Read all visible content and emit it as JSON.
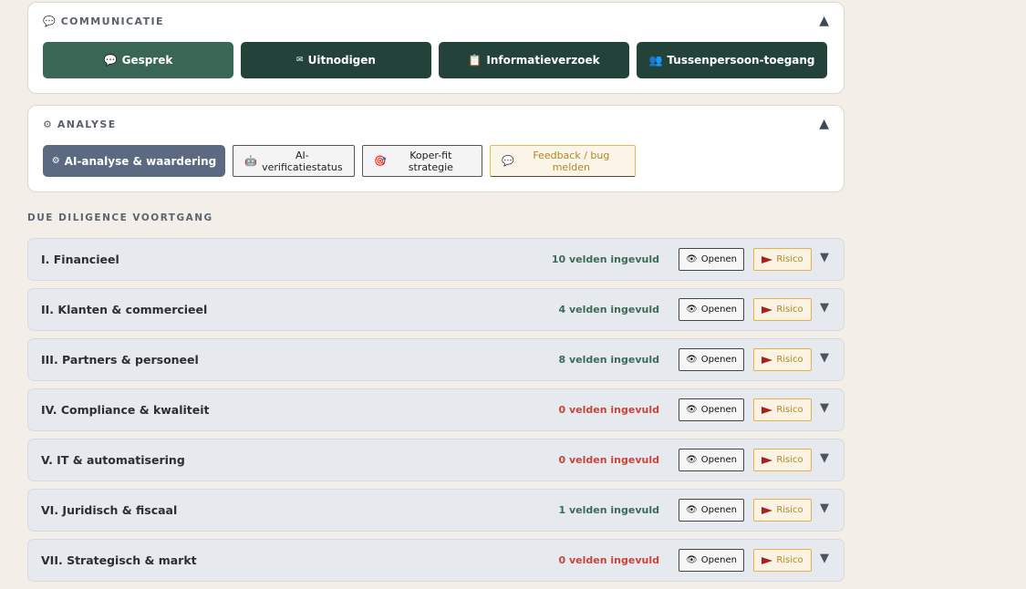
{
  "communicatie": {
    "icon": "💬",
    "title": "COMMUNICATIE",
    "collapse_icon": "▲",
    "buttons": [
      {
        "icon": "💬",
        "label": "Gesprek"
      },
      {
        "icon": "✉",
        "label": "Uitnodigen"
      },
      {
        "icon": "📋",
        "label": "Informatieverzoek"
      },
      {
        "icon": "👥",
        "label": "Tussenpersoon-toegang"
      }
    ]
  },
  "analyse": {
    "icon": "⚙",
    "title": "ANALYSE",
    "collapse_icon": "▲",
    "primary": {
      "icon": "⚙",
      "label": "AI-analyse & waardering"
    },
    "buttons": [
      {
        "icon": "🤖",
        "label": "AI-verificatiestatus"
      },
      {
        "icon": "🎯",
        "label": "Koper-fit strategie"
      }
    ],
    "feedback": {
      "icon": "💬",
      "label": "Feedback / bug melden"
    }
  },
  "due_diligence": {
    "section_label": "DUE DILIGENCE VOORTGANG",
    "open_icon": "👁",
    "open_label": "Openen",
    "risk_label": "Risico",
    "chevron": "▼",
    "sections": [
      {
        "title": "I. Financieel",
        "count": "10 velden ingevuld",
        "filled": 10
      },
      {
        "title": "II. Klanten & commercieel",
        "count": "4 velden ingevuld",
        "filled": 4
      },
      {
        "title": "III. Partners & personeel",
        "count": "8 velden ingevuld",
        "filled": 8
      },
      {
        "title": "IV. Compliance & kwaliteit",
        "count": "0 velden ingevuld",
        "filled": 0
      },
      {
        "title": "V. IT & automatisering",
        "count": "0 velden ingevuld",
        "filled": 0
      },
      {
        "title": "VI. Juridisch & fiscaal",
        "count": "1 velden ingevuld",
        "filled": 1
      },
      {
        "title": "VII. Strategisch & markt",
        "count": "0 velden ingevuld",
        "filled": 0
      }
    ]
  },
  "colors": {
    "page_bg": "#f3efe8",
    "dark_green": "#23423a",
    "active_green": "#3a6656",
    "slate": "#5b6a80",
    "count_positive": "#3d6a58",
    "count_zero": "#c8453d",
    "risk_accent": "#e3b24a"
  }
}
